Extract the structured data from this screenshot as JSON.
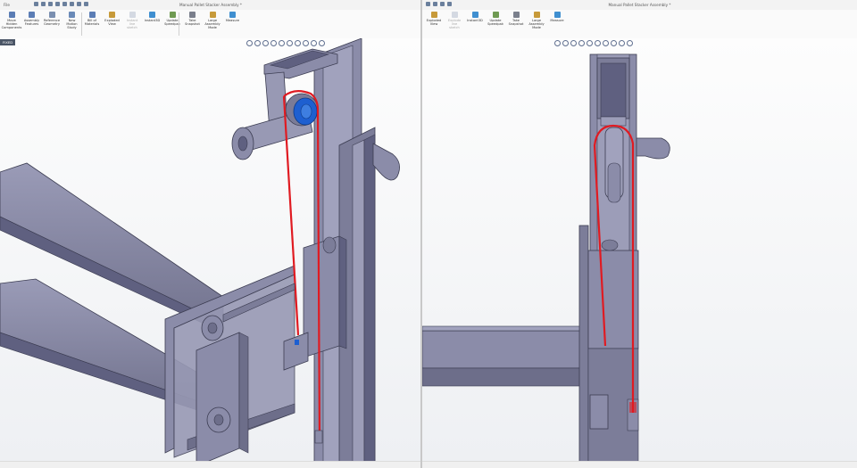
{
  "left_window": {
    "title": "Manual Pallet Stacker Assembly *",
    "menu": "File",
    "ribbon": [
      {
        "label": "Move\nHidden\nComponents",
        "color": "#5b7db5",
        "disabled": false
      },
      {
        "label": "Assembly\nFeatures",
        "color": "#5b7db5",
        "disabled": false
      },
      {
        "label": "Reference\nGeometry",
        "color": "#7a8fb0",
        "disabled": false
      },
      {
        "label": "New\nMotion\nStudy",
        "color": "#6a8ab8",
        "disabled": false
      },
      {
        "label": "Bill of\nMaterials",
        "color": "#5b7db5",
        "disabled": false
      },
      {
        "label": "Exploded\nView",
        "color": "#c79a3a",
        "disabled": false
      },
      {
        "label": "Instant\nline\nsketch",
        "color": "#9aa8bd",
        "disabled": true
      },
      {
        "label": "Instant3D",
        "color": "#3f8fd0",
        "disabled": false
      },
      {
        "label": "Update\nSpeedpak",
        "color": "#6f9a52",
        "disabled": false
      },
      {
        "label": "Take\nSnapshot",
        "color": "#7a7f8c",
        "disabled": false
      },
      {
        "label": "Large\nAssembly\nMode",
        "color": "#c79a3a",
        "disabled": false
      },
      {
        "label": "Measure",
        "color": "#3f8fd0",
        "disabled": false
      }
    ],
    "tab_label": "FIXED",
    "colors": {
      "part": "#8b8ca9",
      "part_dark": "#5f6080",
      "part_light": "#a9aac2",
      "belt": "#e01b22",
      "pulley_blue": "#1e5fd0"
    }
  },
  "right_window": {
    "title": "Manual Pallet Stacker Assembly *",
    "ribbon": [
      {
        "label": "Exploded\nView",
        "color": "#c79a3a",
        "disabled": false
      },
      {
        "label": "Explode\nline\nsketch",
        "color": "#9aa8bd",
        "disabled": true
      },
      {
        "label": "Instant3D",
        "color": "#3f8fd0",
        "disabled": false
      },
      {
        "label": "Update\nSpeedpak",
        "color": "#6f9a52",
        "disabled": false
      },
      {
        "label": "Take\nSnapshot",
        "color": "#7a7f8c",
        "disabled": false
      },
      {
        "label": "Large\nAssembly\nMode",
        "color": "#c79a3a",
        "disabled": false
      },
      {
        "label": "Measure",
        "color": "#3f8fd0",
        "disabled": false
      }
    ]
  }
}
